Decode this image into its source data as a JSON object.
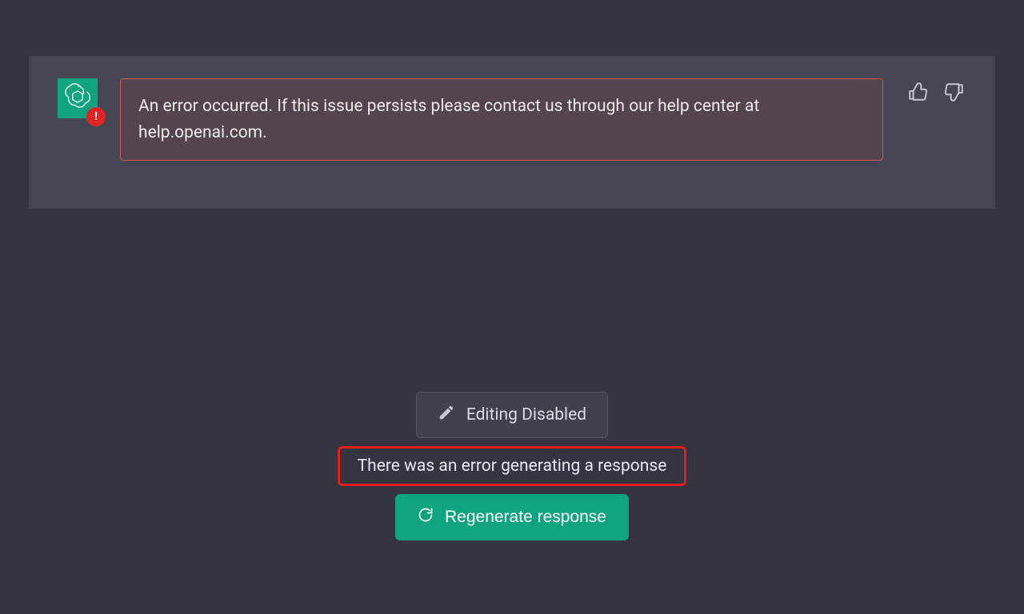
{
  "assistant": {
    "error_message": "An error occurred. If this issue persists please contact us through our help center at help.openai.com.",
    "avatar_badge": "!",
    "avatar_bg": "#10a37f",
    "badge_bg": "#e02424"
  },
  "feedback": {
    "thumbs_up_icon": "thumbs-up",
    "thumbs_down_icon": "thumbs-down"
  },
  "bottom": {
    "editing_disabled_label": "Editing Disabled",
    "generation_error_text": "There was an error generating a response",
    "regenerate_label": "Regenerate response"
  },
  "colors": {
    "page_bg": "#343541",
    "row_bg": "#444654",
    "error_border": "#d9534f",
    "highlight_border": "#e21b1b",
    "accent": "#10a37f"
  }
}
